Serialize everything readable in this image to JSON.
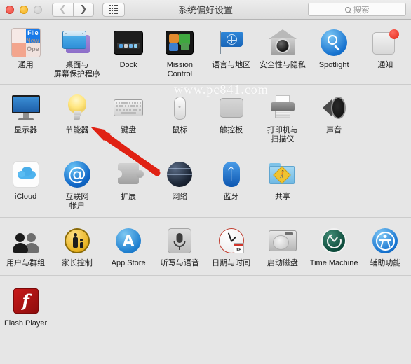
{
  "window": {
    "title": "系统偏好设置",
    "traffic_lights": [
      "close",
      "minimize",
      "zoom"
    ],
    "nav": {
      "back_icon": "chevron-left-icon",
      "forward_icon": "chevron-right-icon",
      "grid_icon": "grid-dots-icon"
    },
    "search": {
      "placeholder": "搜索",
      "icon": "search-icon"
    }
  },
  "watermark": "www.pc841.com",
  "annotation": {
    "type": "red-arrow",
    "points_to": "节能器",
    "color": "#e02214"
  },
  "rows": [
    {
      "items": [
        {
          "label": "通用",
          "icon": "general-icon"
        },
        {
          "label": "桌面与\n屏幕保护程序",
          "icon": "desktop-screensaver-icon"
        },
        {
          "label": "Dock",
          "icon": "dock-icon"
        },
        {
          "label": "Mission\nControl",
          "icon": "mission-control-icon"
        },
        {
          "label": "语言与地区",
          "icon": "language-region-icon"
        },
        {
          "label": "安全性与隐私",
          "icon": "security-privacy-icon"
        },
        {
          "label": "Spotlight",
          "icon": "spotlight-icon"
        },
        {
          "label": "通知",
          "icon": "notifications-icon"
        }
      ]
    },
    {
      "items": [
        {
          "label": "显示器",
          "icon": "displays-icon"
        },
        {
          "label": "节能器",
          "icon": "energy-saver-icon"
        },
        {
          "label": "键盘",
          "icon": "keyboard-icon"
        },
        {
          "label": "鼠标",
          "icon": "mouse-icon"
        },
        {
          "label": "触控板",
          "icon": "trackpad-icon"
        },
        {
          "label": "打印机与\n扫描仪",
          "icon": "printers-scanners-icon"
        },
        {
          "label": "声音",
          "icon": "sound-icon"
        }
      ]
    },
    {
      "items": [
        {
          "label": "iCloud",
          "icon": "icloud-icon"
        },
        {
          "label": "互联网\n帐户",
          "icon": "internet-accounts-icon"
        },
        {
          "label": "扩展",
          "icon": "extensions-icon"
        },
        {
          "label": "网络",
          "icon": "network-icon"
        },
        {
          "label": "蓝牙",
          "icon": "bluetooth-icon"
        },
        {
          "label": "共享",
          "icon": "sharing-icon"
        }
      ]
    },
    {
      "items": [
        {
          "label": "用户与群组",
          "icon": "users-groups-icon"
        },
        {
          "label": "家长控制",
          "icon": "parental-controls-icon"
        },
        {
          "label": "App Store",
          "icon": "app-store-icon"
        },
        {
          "label": "听写与语音",
          "icon": "dictation-speech-icon"
        },
        {
          "label": "日期与时间",
          "icon": "date-time-icon"
        },
        {
          "label": "启动磁盘",
          "icon": "startup-disk-icon"
        },
        {
          "label": "Time Machine",
          "icon": "time-machine-icon"
        },
        {
          "label": "辅助功能",
          "icon": "accessibility-icon"
        }
      ]
    },
    {
      "items": [
        {
          "label": "Flash Player",
          "icon": "flash-player-icon"
        }
      ]
    }
  ],
  "date_time_badge": "18",
  "colors": {
    "window_bg": "#e6e6e6",
    "titlebar_top": "#ededed",
    "titlebar_bottom": "#dcdcdc",
    "divider": "#cccccc",
    "label_text": "#1d1d1d",
    "arrow_red": "#e02214"
  }
}
